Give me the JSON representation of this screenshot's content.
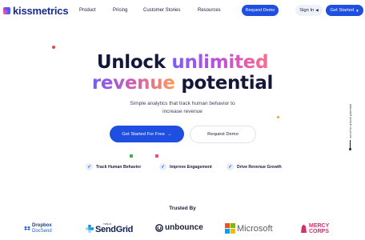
{
  "brand": {
    "name": "kissmetrics"
  },
  "nav": {
    "links": [
      "Product",
      "Pricing",
      "Customer Stories",
      "Resources"
    ],
    "request_demo": "Request Demo",
    "sign_in": "Sign In",
    "get_started": "Get Started"
  },
  "hero": {
    "line1_a": "Unlock",
    "line1_b": "unlimited",
    "line2_a": "revenue",
    "line2_b": "potential",
    "subtitle": "Simple analytics that track human behavior to increase revenue",
    "cta_primary": "Get Started For Free",
    "cta_secondary": "Request Demo",
    "features": [
      "Track Human Behavior",
      "Improve Engagement",
      "Drive Revenue Growth"
    ],
    "scroll_hint": "scroll to unlock potential"
  },
  "trusted": {
    "title": "Trusted By",
    "logos": {
      "dropbox_line1": "Dropbox",
      "dropbox_line2": "DocSend",
      "sendgrid_small": "TWILIO",
      "sendgrid": "SendGrid",
      "unbounce": "unbounce",
      "microsoft": "Microsoft",
      "mercy_line1": "MERCY",
      "mercy_line2": "CORPS"
    }
  },
  "colors": {
    "accent": "#1f4fe0",
    "text_dark": "#14163a",
    "decor_red": "#e8463c",
    "decor_green": "#3bb54a",
    "decor_orange": "#f0a030",
    "decor_pink": "#e8508c"
  }
}
